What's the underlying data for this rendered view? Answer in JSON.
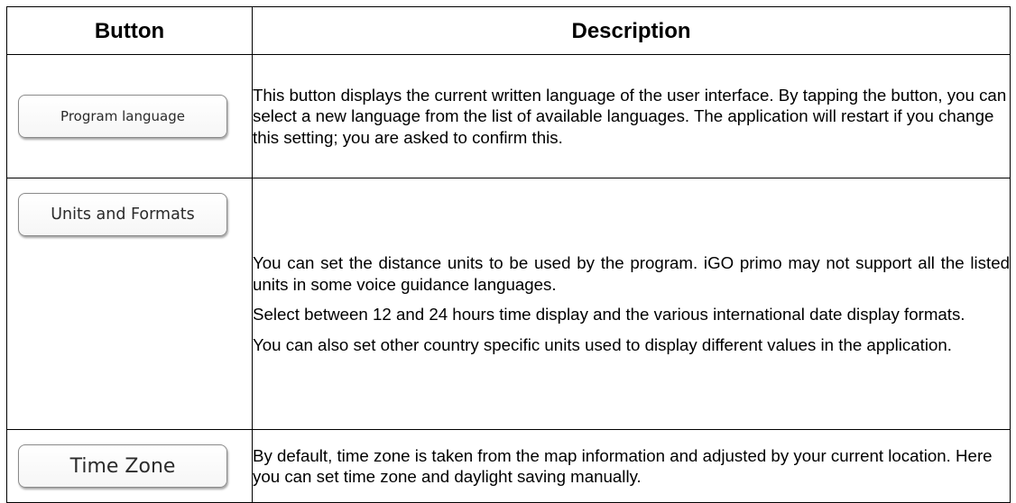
{
  "table": {
    "headers": {
      "button": "Button",
      "description": "Description"
    },
    "rows": [
      {
        "button_label": "Program language",
        "paragraphs": [
          "This button displays the current written language of the user interface. By tapping the button, you can select a new language from the list of available languages. The application will restart if you change this setting; you are asked to confirm this."
        ]
      },
      {
        "button_label": "Units and Formats",
        "paragraphs": [
          "You can set the distance units to be used by the program. iGO primo may not support all the listed units in some voice guidance languages.",
          "Select between 12 and 24 hours time display and the various international date display formats.",
          "You can also set other country specific units used to display different values in the application."
        ]
      },
      {
        "button_label": "Time Zone",
        "paragraphs": [
          "By default, time zone is taken from the map information and adjusted by your current location. Here you can set time zone and daylight saving manually."
        ]
      }
    ]
  }
}
